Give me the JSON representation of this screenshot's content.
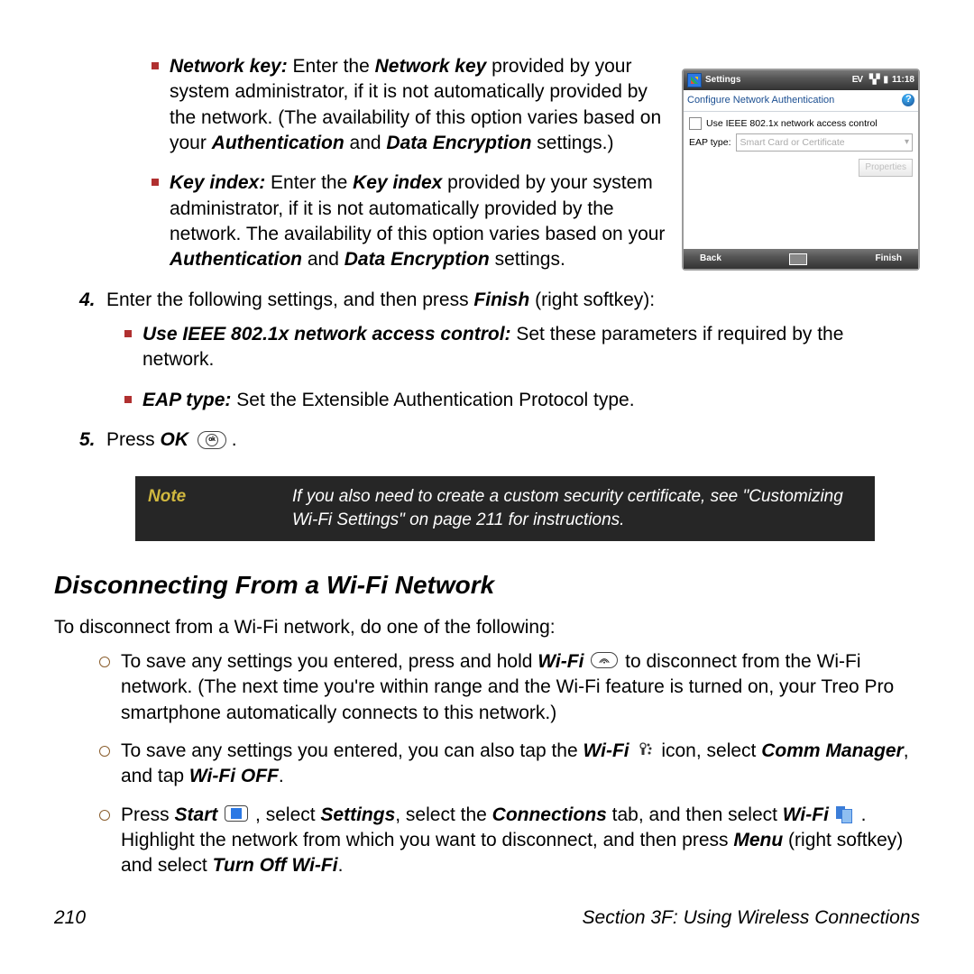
{
  "bullets": {
    "network_key": {
      "title": "Network key:",
      "text_a": " Enter the ",
      "bold": "Network key",
      "text_b": " provided by your system administrator, if it is not automatically provided by the network. (The availability of this option varies based on your ",
      "auth": "Authentication",
      "and": " and ",
      "enc": "Data Encryption",
      "tail": " settings.)"
    },
    "key_index": {
      "title": "Key index:",
      "text_a": " Enter the ",
      "bold": "Key index",
      "text_b": " provided by your system administrator, if it is not automatically provided by the network. The availability of this option varies based on your ",
      "auth": "Authentication",
      "and": " and ",
      "enc": "Data Encryption",
      "tail": " settings."
    }
  },
  "step4": {
    "num": "4.",
    "lead_a": "Enter the following settings, and then press ",
    "finish": "Finish",
    "lead_b": " (right softkey):",
    "ieee": {
      "title": "Use IEEE 802.1x network access control:",
      "text": " Set these parameters if required by the network."
    },
    "eap": {
      "title": "EAP type:",
      "text": " Set the Extensible Authentication Protocol type."
    }
  },
  "step5": {
    "num": "5.",
    "lead": "Press ",
    "ok": "OK",
    "tail": " ."
  },
  "screenshot": {
    "title": "Settings",
    "time": "11:18",
    "signal": "EV",
    "subtitle": "Configure Network Authentication",
    "checkbox": "Use IEEE 802.1x network access control",
    "eap_label": "EAP type:",
    "eap_value": "Smart Card or Certificate",
    "props_btn": "Properties",
    "left": "Back",
    "right": "Finish"
  },
  "note": {
    "label": "Note",
    "text": "If you also need to create a custom security certificate, see \"Customizing Wi-Fi Settings\" on page 211 for instructions."
  },
  "heading": "Disconnecting From a Wi-Fi Network",
  "intro": "To disconnect from a Wi-Fi network, do one of the following:",
  "disc": {
    "a1": "To save any settings you entered, press and hold ",
    "a_b": "Wi-Fi",
    "a2": " to disconnect from the Wi-Fi network. (The next time you're within range and the Wi-Fi feature is turned on, your Treo Pro smartphone automatically connects to this network.)",
    "b1": "To save any settings you entered, you can also tap the ",
    "b_b1": "Wi-Fi",
    "b2": " icon, select ",
    "b_b2": "Comm Manager",
    "b3": ", and tap ",
    "b_b3": "Wi-Fi OFF",
    "b4": ".",
    "c1": "Press ",
    "c_b1": "Start",
    "c2": " , select ",
    "c_b2": "Settings",
    "c3": ", select the ",
    "c_b3": "Connections",
    "c4": " tab, and then select ",
    "c_b4": "Wi-Fi",
    "c5": " . Highlight the network from which you want to disconnect, and then press ",
    "c_b5": "Menu",
    "c6": " (right softkey) and select ",
    "c_b6": "Turn Off Wi-Fi",
    "c7": "."
  },
  "footer": {
    "page": "210",
    "section": "Section 3F: Using Wireless Connections"
  }
}
